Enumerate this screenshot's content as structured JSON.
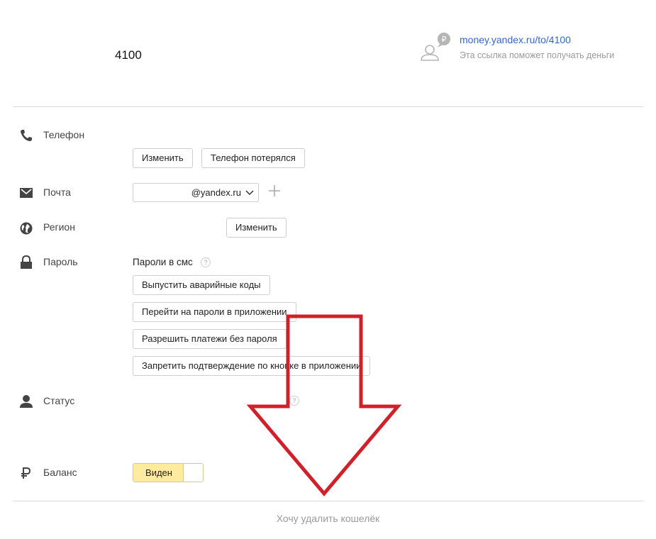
{
  "header": {
    "account_number": "4100",
    "link_url": "money.yandex.ru/to/4100",
    "link_hint": "Эта ссылка поможет получать деньги",
    "link_badge": "₽"
  },
  "phone": {
    "label": "Телефон",
    "change_label": "Изменить",
    "lost_label": "Телефон потерялся"
  },
  "email": {
    "label": "Почта",
    "selected_value": "@yandex.ru"
  },
  "region": {
    "label": "Регион",
    "change_label": "Изменить"
  },
  "password": {
    "label": "Пароль",
    "sms_label": "Пароли в смс",
    "help": "?",
    "buttons": [
      "Выпустить аварийные коды",
      "Перейти на пароли в приложении",
      "Разрешить платежи без пароля",
      "Запретить подтверждение по кнопке в приложении"
    ]
  },
  "status": {
    "label": "Статус",
    "help": "?"
  },
  "balance": {
    "label": "Баланс",
    "toggle_label": "Виден"
  },
  "delete_link": "Хочу удалить кошелёк",
  "colors": {
    "link": "#3366cc",
    "toggle_on": "#ffeba0",
    "annotation_arrow": "#d0202a"
  },
  "icons": [
    "phone-icon",
    "mail-icon",
    "globe-icon",
    "lock-icon",
    "user-icon",
    "ruble-icon",
    "profile-link-icon",
    "chevron-down-icon",
    "plus-icon",
    "help-icon"
  ]
}
